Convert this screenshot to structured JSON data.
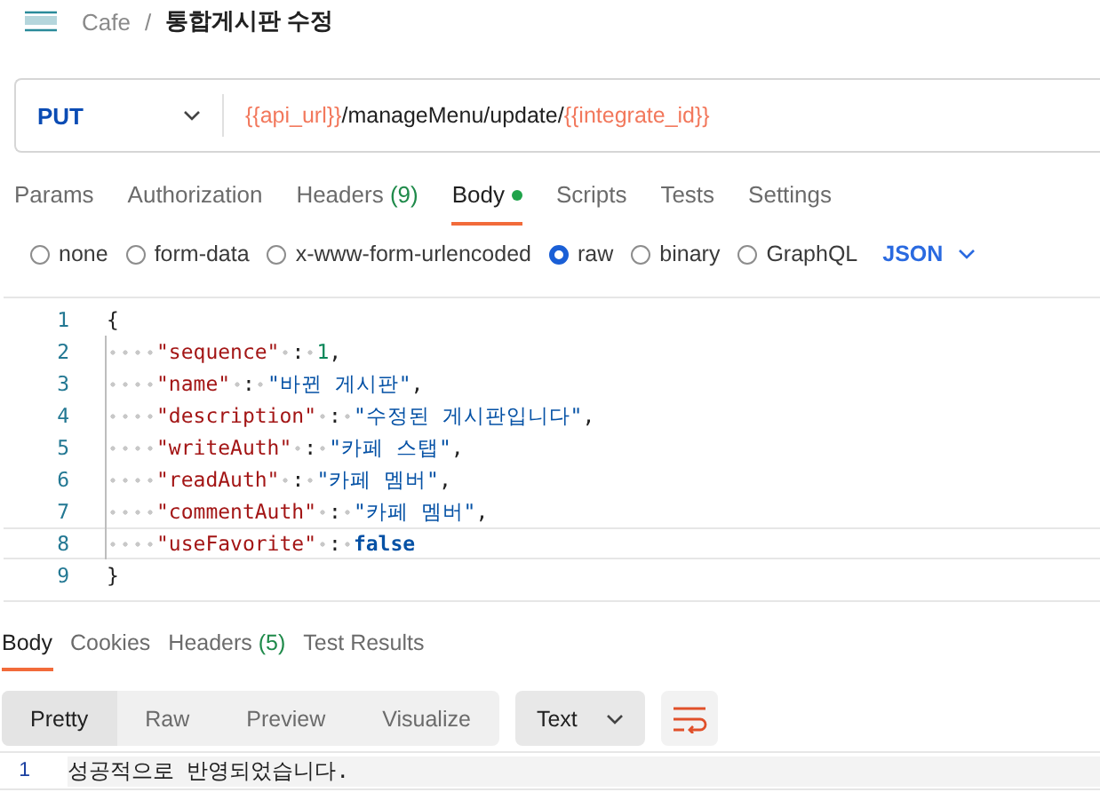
{
  "breadcrumb": {
    "collection": "Cafe",
    "separator": "/",
    "request": "통합게시판 수정"
  },
  "request": {
    "method": "PUT",
    "url": [
      {
        "kind": "var",
        "text": "{{api_url}}"
      },
      {
        "kind": "plain",
        "text": "/manageMenu/update/"
      },
      {
        "kind": "var",
        "text": "{{integrate_id}}"
      }
    ]
  },
  "tabs": [
    {
      "label": "Params",
      "selected": false
    },
    {
      "label": "Authorization",
      "selected": false
    },
    {
      "label": "Headers",
      "count": "(9)",
      "selected": false
    },
    {
      "label": "Body",
      "selected": true,
      "dot": true
    },
    {
      "label": "Scripts",
      "selected": false
    },
    {
      "label": "Tests",
      "selected": false
    },
    {
      "label": "Settings",
      "selected": false
    }
  ],
  "body_types": [
    {
      "label": "none",
      "selected": false
    },
    {
      "label": "form-data",
      "selected": false
    },
    {
      "label": "x-www-form-urlencoded",
      "selected": false
    },
    {
      "label": "raw",
      "selected": true
    },
    {
      "label": "binary",
      "selected": false
    },
    {
      "label": "GraphQL",
      "selected": false
    }
  ],
  "format": "JSON",
  "editor": {
    "lines": [
      {
        "number": "1",
        "tokens": [
          {
            "kind": "punct",
            "text": "{"
          }
        ]
      },
      {
        "number": "2",
        "tokens": [
          {
            "kind": "indent"
          },
          {
            "kind": "key",
            "text": "\"sequence\""
          },
          {
            "kind": "ws"
          },
          {
            "kind": "punct",
            "text": ":"
          },
          {
            "kind": "ws"
          },
          {
            "kind": "number",
            "text": "1"
          },
          {
            "kind": "punct",
            "text": ","
          }
        ]
      },
      {
        "number": "3",
        "tokens": [
          {
            "kind": "indent"
          },
          {
            "kind": "key",
            "text": "\"name\""
          },
          {
            "kind": "ws"
          },
          {
            "kind": "punct",
            "text": ":"
          },
          {
            "kind": "ws"
          },
          {
            "kind": "string",
            "text": "\"바뀐 게시판\""
          },
          {
            "kind": "punct",
            "text": ","
          }
        ]
      },
      {
        "number": "4",
        "tokens": [
          {
            "kind": "indent"
          },
          {
            "kind": "key",
            "text": "\"description\""
          },
          {
            "kind": "ws"
          },
          {
            "kind": "punct",
            "text": ":"
          },
          {
            "kind": "ws"
          },
          {
            "kind": "string",
            "text": "\"수정된 게시판입니다\""
          },
          {
            "kind": "punct",
            "text": ","
          }
        ]
      },
      {
        "number": "5",
        "tokens": [
          {
            "kind": "indent"
          },
          {
            "kind": "key",
            "text": "\"writeAuth\""
          },
          {
            "kind": "ws"
          },
          {
            "kind": "punct",
            "text": ":"
          },
          {
            "kind": "ws"
          },
          {
            "kind": "string",
            "text": "\"카페 스탭\""
          },
          {
            "kind": "punct",
            "text": ","
          }
        ]
      },
      {
        "number": "6",
        "tokens": [
          {
            "kind": "indent"
          },
          {
            "kind": "key",
            "text": "\"readAuth\""
          },
          {
            "kind": "ws"
          },
          {
            "kind": "punct",
            "text": ":"
          },
          {
            "kind": "ws"
          },
          {
            "kind": "string",
            "text": "\"카페 멤버\""
          },
          {
            "kind": "punct",
            "text": ","
          }
        ]
      },
      {
        "number": "7",
        "tokens": [
          {
            "kind": "indent"
          },
          {
            "kind": "key",
            "text": "\"commentAuth\""
          },
          {
            "kind": "ws"
          },
          {
            "kind": "punct",
            "text": ":"
          },
          {
            "kind": "ws"
          },
          {
            "kind": "string",
            "text": "\"카페 멤버\""
          },
          {
            "kind": "punct",
            "text": ","
          }
        ]
      },
      {
        "number": "8",
        "current": true,
        "tokens": [
          {
            "kind": "indent"
          },
          {
            "kind": "key",
            "text": "\"useFavorite\""
          },
          {
            "kind": "ws"
          },
          {
            "kind": "punct",
            "text": ":"
          },
          {
            "kind": "ws"
          },
          {
            "kind": "keyword",
            "text": "false"
          }
        ]
      },
      {
        "number": "9",
        "tokens": [
          {
            "kind": "punct",
            "text": "}"
          }
        ]
      }
    ]
  },
  "response": {
    "tabs": [
      {
        "label": "Body",
        "selected": true
      },
      {
        "label": "Cookies",
        "selected": false
      },
      {
        "label": "Headers",
        "count": "(5)",
        "selected": false
      },
      {
        "label": "Test Results",
        "selected": false
      }
    ],
    "views": [
      {
        "label": "Pretty",
        "selected": true
      },
      {
        "label": "Raw",
        "selected": false
      },
      {
        "label": "Preview",
        "selected": false
      },
      {
        "label": "Visualize",
        "selected": false
      }
    ],
    "format": "Text",
    "lines": [
      {
        "number": "1",
        "text": "성공적으로 반영되었습니다."
      }
    ]
  }
}
